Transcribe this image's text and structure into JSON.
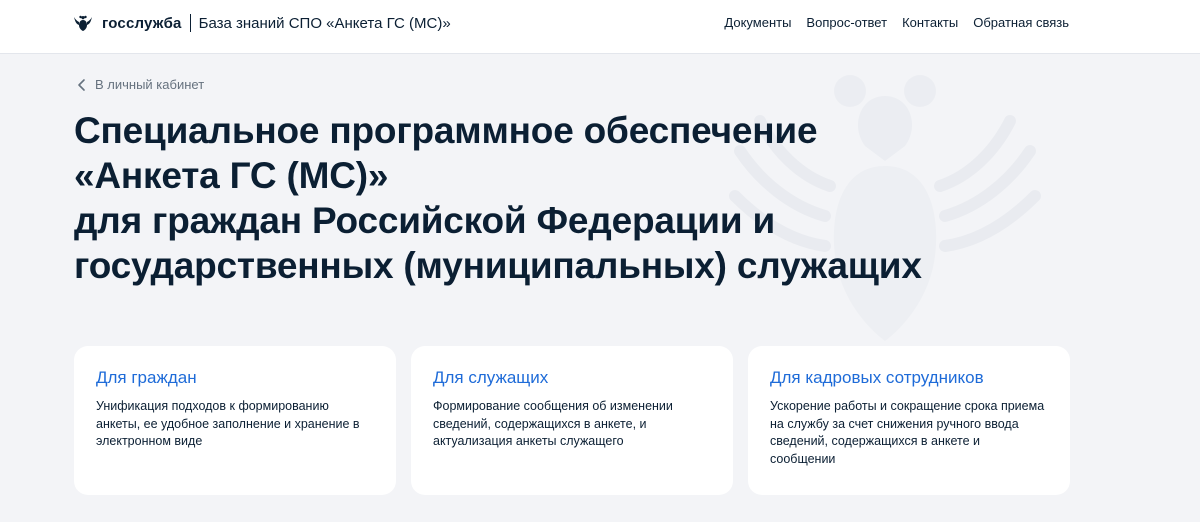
{
  "header": {
    "brand": "госслужба",
    "site_title": "База знаний СПО «Анкета ГС (МС)»",
    "nav": [
      "Документы",
      "Вопрос-ответ",
      "Контакты",
      "Обратная связь"
    ]
  },
  "back_link": "В личный кабинет",
  "title_lines": [
    "Специальное программное обеспечение",
    "«Анкета ГС (МС)»",
    "для граждан Российской Федерации и",
    "государственных (муниципальных) служащих"
  ],
  "cards": [
    {
      "title": "Для граждан",
      "text": "Унификация подходов к формированию анкеты, ее удобное заполнение и хранение в электронном виде"
    },
    {
      "title": "Для служащих",
      "text": "Формирование сообщения об изменении сведений, содержащихся в анкете, и актуализация анкеты служащего"
    },
    {
      "title": "Для кадровых сотрудников",
      "text": "Ускорение работы и сокращение срока приема на службу за счет снижения ручного ввода сведений, содержащихся в анкете и сообщении"
    }
  ],
  "colors": {
    "accent": "#1e6bd8",
    "text": "#0b1f33",
    "muted": "#66727f",
    "background": "#f3f4f7"
  },
  "icons": {
    "logo": "eagle-icon",
    "back": "chevron-left-icon",
    "background": "emblem-watermark"
  }
}
